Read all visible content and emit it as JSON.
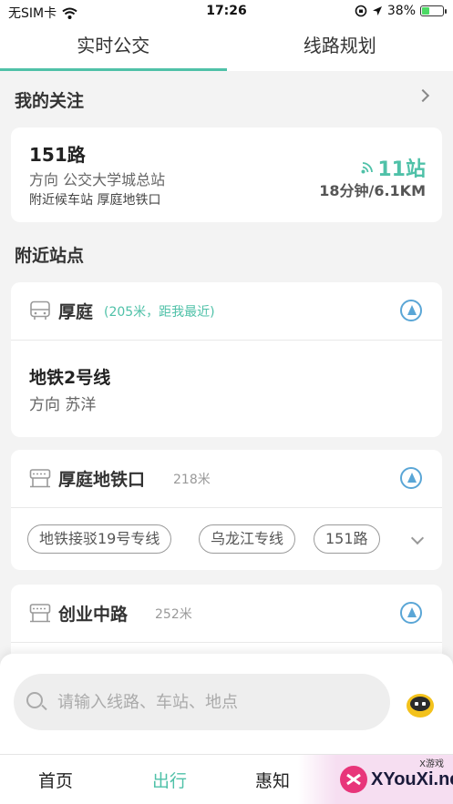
{
  "status_bar": {
    "carrier": "无SIM卡",
    "time": "17:26",
    "battery": "38%",
    "battery_level": 0.38
  },
  "top_tabs": [
    {
      "label": "实时公交",
      "active": true
    },
    {
      "label": "线路规划",
      "active": false
    }
  ],
  "favorites": {
    "title": "我的关注",
    "item": {
      "route": "151路",
      "direction": "方向  公交大学城总站",
      "nearby_stop": "附近候车站 厚庭地铁口",
      "stops_away": "11站",
      "eta": "18分钟/6.1KM"
    }
  },
  "nearby": {
    "title": "附近站点",
    "stops": [
      {
        "name": "厚庭",
        "meta": "(205米，距我最近)",
        "icon": "bus-icon",
        "lines": [
          {
            "name": "地铁2号线",
            "direction": "方向  苏洋"
          }
        ]
      },
      {
        "name": "厚庭地铁口",
        "meta": "218米",
        "icon": "bus-stop-icon",
        "chips": [
          "地铁接驳19号专线",
          "乌龙江专线",
          "151路"
        ]
      },
      {
        "name": "创业中路",
        "meta": "252米",
        "icon": "bus-stop-icon"
      }
    ]
  },
  "search": {
    "placeholder": "请输入线路、车站、地点"
  },
  "bottom_nav": [
    {
      "label": "首页",
      "active": false
    },
    {
      "label": "出行",
      "active": true
    },
    {
      "label": "惠知",
      "active": false
    }
  ],
  "watermark": {
    "text": "XYouXi.net",
    "sub": "X游戏"
  },
  "colors": {
    "accent": "#4fc1a8",
    "nav_blue": "#5aa6d6"
  }
}
